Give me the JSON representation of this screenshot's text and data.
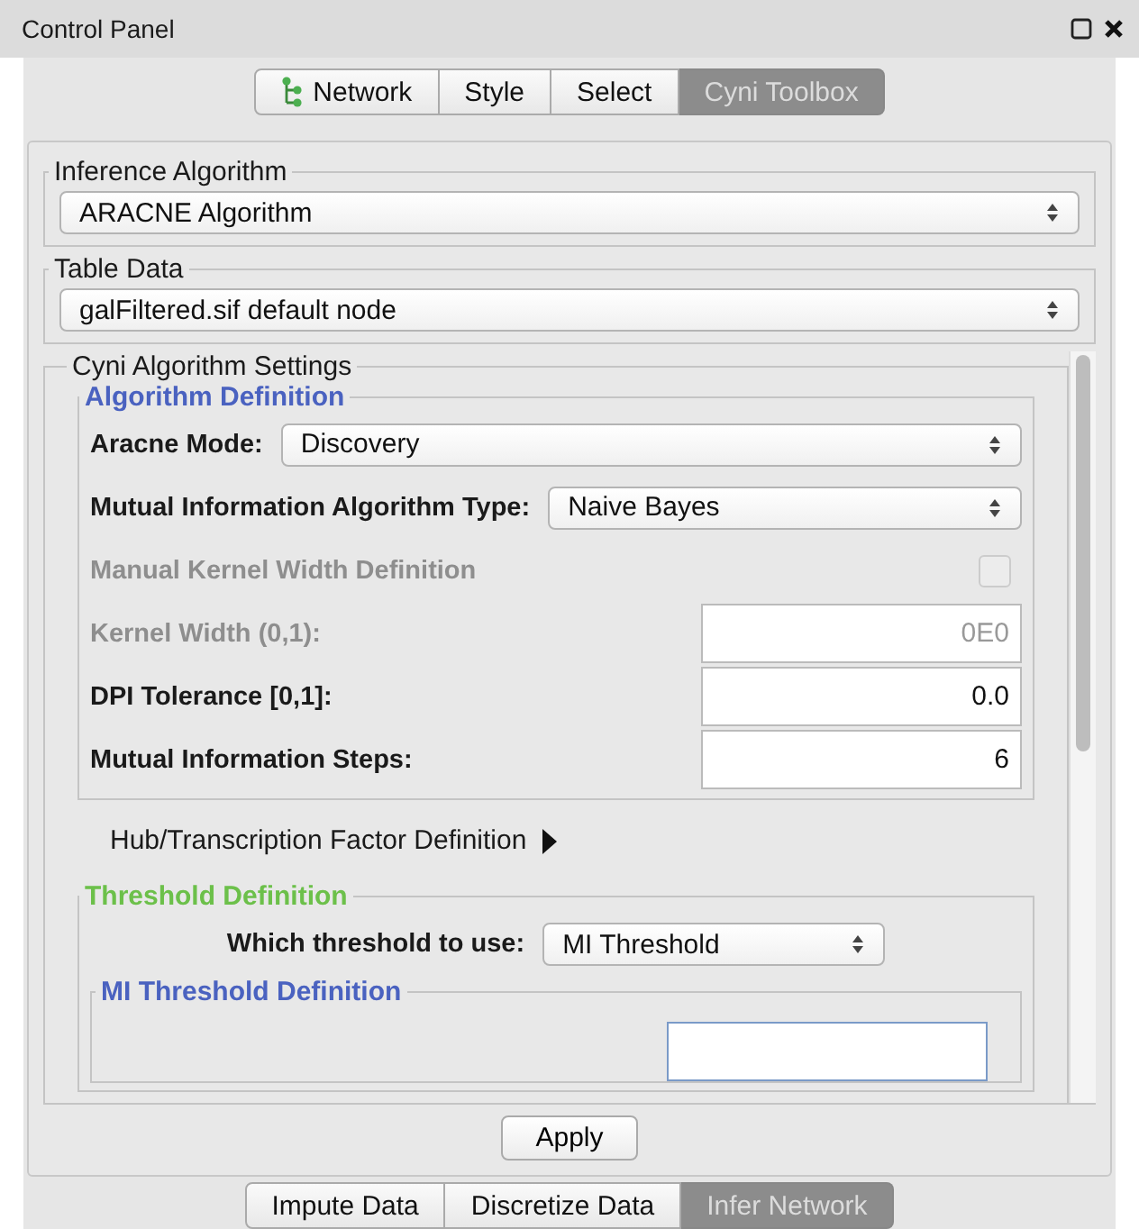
{
  "window": {
    "title": "Control Panel"
  },
  "tabs": [
    {
      "label": "Network",
      "icon": true,
      "selected": false
    },
    {
      "label": "Style",
      "selected": false
    },
    {
      "label": "Select",
      "selected": false
    },
    {
      "label": "Cyni Toolbox",
      "selected": true
    }
  ],
  "inference_algorithm": {
    "legend": "Inference Algorithm",
    "value": "ARACNE Algorithm"
  },
  "table_data": {
    "legend": "Table Data",
    "value": "galFiltered.sif default node"
  },
  "settings": {
    "legend": "Cyni Algorithm Settings",
    "algorithm_definition": {
      "legend": "Algorithm Definition",
      "rows": [
        {
          "kind": "select",
          "label": "Aracne Mode:",
          "value": "Discovery",
          "disabled": false
        },
        {
          "kind": "select",
          "label": "Mutual Information Algorithm Type:",
          "value": "Naive Bayes",
          "disabled": false
        },
        {
          "kind": "checkbox",
          "label": "Manual Kernel Width Definition",
          "checked": false,
          "disabled": true
        },
        {
          "kind": "input",
          "label": "Kernel Width (0,1):",
          "value": "0E0",
          "disabled": true
        },
        {
          "kind": "input",
          "label": "DPI Tolerance [0,1]:",
          "value": "0.0",
          "disabled": false
        },
        {
          "kind": "input",
          "label": "Mutual Information Steps:",
          "value": "6",
          "disabled": false
        }
      ]
    },
    "hub_definition": {
      "label": "Hub/Transcription Factor Definition",
      "expanded": false
    },
    "threshold_definition": {
      "legend": "Threshold Definition",
      "label": "Which threshold to use:",
      "value": "MI Threshold"
    },
    "mi_threshold_definition": {
      "legend": "MI Threshold Definition"
    }
  },
  "apply_button": "Apply",
  "bottom_tabs": [
    {
      "label": "Impute Data",
      "selected": false
    },
    {
      "label": "Discretize Data",
      "selected": false
    },
    {
      "label": "Infer Network",
      "selected": true
    }
  ]
}
